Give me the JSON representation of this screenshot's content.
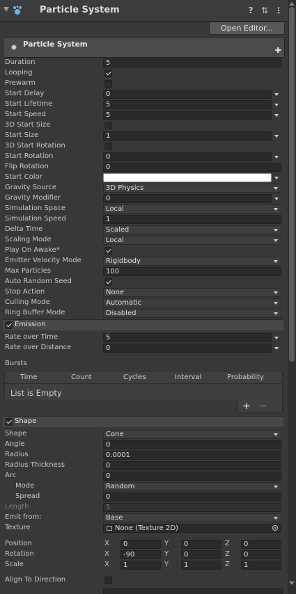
{
  "component": {
    "title": "Particle System",
    "open_editor": "Open Editor..."
  },
  "main_module": {
    "title": "Particle System",
    "rows": [
      {
        "label": "Duration",
        "kind": "text",
        "value": "5"
      },
      {
        "label": "Looping",
        "kind": "check",
        "checked": true
      },
      {
        "label": "Prewarm",
        "kind": "check",
        "checked": false
      },
      {
        "label": "Start Delay",
        "kind": "text",
        "value": "0",
        "minmax": true
      },
      {
        "label": "Start Lifetime",
        "kind": "text",
        "value": "5",
        "minmax": true
      },
      {
        "label": "Start Speed",
        "kind": "text",
        "value": "5",
        "minmax": true
      },
      {
        "label": "3D Start Size",
        "kind": "check",
        "checked": false
      },
      {
        "label": "Start Size",
        "kind": "text",
        "value": "1",
        "minmax": true
      },
      {
        "label": "3D Start Rotation",
        "kind": "check",
        "checked": false
      },
      {
        "label": "Start Rotation",
        "kind": "text",
        "value": "0",
        "minmax": true
      },
      {
        "label": "Flip Rotation",
        "kind": "text",
        "value": "0"
      },
      {
        "label": "Start Color",
        "kind": "color",
        "value": "#ffffff",
        "minmax": true
      },
      {
        "label": "Gravity Source",
        "kind": "select",
        "value": "3D Physics"
      },
      {
        "label": "Gravity Modifier",
        "kind": "text",
        "value": "0",
        "minmax": true
      },
      {
        "label": "Simulation Space",
        "kind": "select",
        "value": "Local"
      },
      {
        "label": "Simulation Speed",
        "kind": "text",
        "value": "1"
      },
      {
        "label": "Delta Time",
        "kind": "select",
        "value": "Scaled"
      },
      {
        "label": "Scaling Mode",
        "kind": "select",
        "value": "Local"
      },
      {
        "label": "Play On Awake*",
        "kind": "check",
        "checked": true
      },
      {
        "label": "Emitter Velocity Mode",
        "kind": "select",
        "value": "Rigidbody"
      },
      {
        "label": "Max Particles",
        "kind": "text",
        "value": "100"
      },
      {
        "label": "Auto Random Seed",
        "kind": "check",
        "checked": true
      },
      {
        "label": "Stop Action",
        "kind": "select",
        "value": "None"
      },
      {
        "label": "Culling Mode",
        "kind": "select",
        "value": "Automatic"
      },
      {
        "label": "Ring Buffer Mode",
        "kind": "select",
        "value": "Disabled"
      }
    ]
  },
  "emission": {
    "title": "Emission",
    "enabled": true,
    "rows": [
      {
        "label": "Rate over Time",
        "kind": "text",
        "value": "5",
        "minmax": true
      },
      {
        "label": "Rate over Distance",
        "kind": "text",
        "value": "0",
        "minmax": true
      }
    ],
    "bursts": {
      "label": "Bursts",
      "columns": [
        "Time",
        "Count",
        "Cycles",
        "Interval",
        "Probability"
      ],
      "empty_text": "List is Empty",
      "add": "+",
      "remove": "−"
    }
  },
  "shape": {
    "title": "Shape",
    "enabled": true,
    "rows": [
      {
        "label": "Shape",
        "kind": "select",
        "value": "Cone"
      },
      {
        "label": "Angle",
        "kind": "text",
        "value": "0"
      },
      {
        "label": "Radius",
        "kind": "text",
        "value": "0.0001"
      },
      {
        "label": "Radius Thickness",
        "kind": "text",
        "value": "0"
      },
      {
        "label": "Arc",
        "kind": "text",
        "value": "0"
      },
      {
        "label": "Mode",
        "kind": "select",
        "value": "Random",
        "indent": true
      },
      {
        "label": "Spread",
        "kind": "text",
        "value": "0",
        "indent": true
      },
      {
        "label": "Length",
        "kind": "text",
        "value": "5",
        "disabled": true
      },
      {
        "label": "Emit from:",
        "kind": "select",
        "value": "Base"
      },
      {
        "label": "Texture",
        "kind": "object",
        "value": "None (Texture 2D)"
      }
    ],
    "transform": [
      {
        "label": "Position",
        "x": "0",
        "y": "0",
        "z": "0"
      },
      {
        "label": "Rotation",
        "x": "-90",
        "y": "0",
        "z": "0"
      },
      {
        "label": "Scale",
        "x": "1",
        "y": "1",
        "z": "1"
      }
    ],
    "axis_labels": [
      "X",
      "Y",
      "Z"
    ],
    "after_rows": [
      {
        "label": "Align To Direction",
        "kind": "check",
        "checked": false
      }
    ]
  },
  "icons": {
    "header": [
      "fold-arrow-icon",
      "particle-system-icon",
      "help-icon",
      "preset-icon",
      "more-icon"
    ]
  }
}
